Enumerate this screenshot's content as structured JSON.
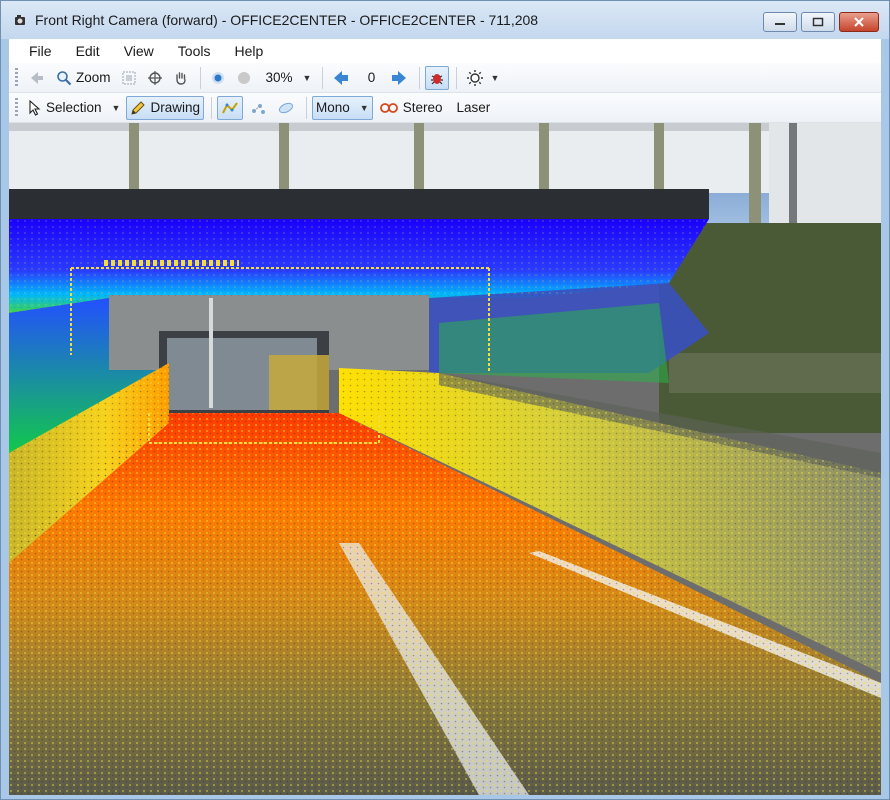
{
  "window": {
    "title": "Front Right Camera (forward) - OFFICE2CENTER - OFFICE2CENTER - 711,208"
  },
  "menu": [
    "File",
    "Edit",
    "View",
    "Tools",
    "Help"
  ],
  "toolbar1": {
    "zoom_label": "Zoom",
    "zoom_level": "30%",
    "frame_counter": "0"
  },
  "toolbar2": {
    "selection_label": "Selection",
    "drawing_label": "Drawing",
    "mono_label": "Mono",
    "stereo_label": "Stereo",
    "laser_label": "Laser"
  },
  "icons": {
    "app": "camera-icon",
    "back": "arrow-left-icon",
    "zoom": "magnifier-icon",
    "prev_frame": "arrow-left-icon",
    "next_frame": "arrow-right-icon",
    "record": "bug-icon",
    "brightness": "sun-icon"
  },
  "colors": {
    "title_bar": "#c3d7ee",
    "close_button": "#c6442c",
    "active_button": "#c8def5",
    "point_cloud_near": "#ff2a00",
    "point_cloud_far": "#1b00ff"
  }
}
